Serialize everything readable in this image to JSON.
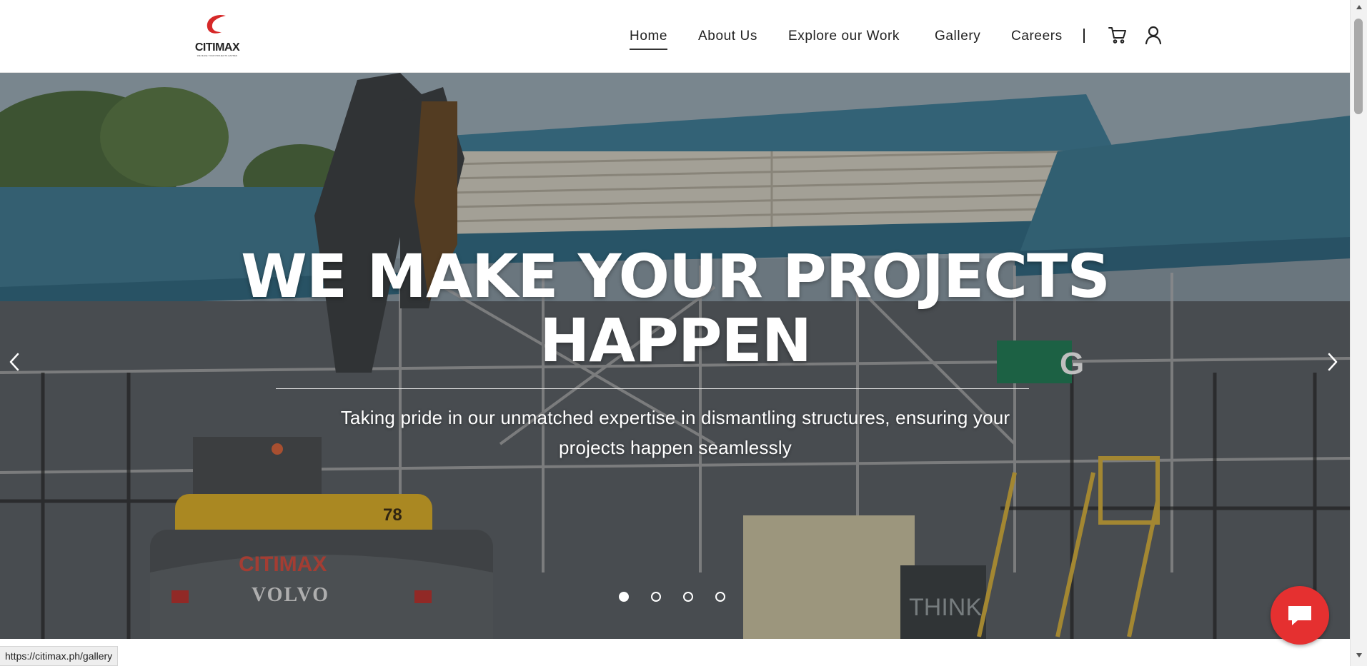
{
  "brand": {
    "name": "CITIMAX",
    "tagline": "WE MAKE YOUR PROJECTS HAPPEN",
    "accent_color": "#d62828"
  },
  "nav": {
    "items": [
      {
        "label": "Home",
        "active": true
      },
      {
        "label": "About Us",
        "active": false
      },
      {
        "label": "Explore our Work",
        "active": false
      },
      {
        "label": "Gallery",
        "active": false
      },
      {
        "label": "Careers",
        "active": false
      }
    ],
    "cart_icon": "cart-icon",
    "account_icon": "user-icon"
  },
  "hero": {
    "title": "WE MAKE YOUR PROJECTS HAPPEN",
    "subtitle": "Taking pride in our unmatched expertise in dismantling structures, ensuring your projects happen seamlessly",
    "prev_icon": "chevron-left-icon",
    "next_icon": "chevron-right-icon",
    "slides_total": 4,
    "active_slide": 1,
    "excavator_brand": "VOLVO",
    "excavator_number": "78",
    "excavator_decal": "CITIMAX",
    "sign_text": "THINK",
    "station_sign": "G"
  },
  "chat": {
    "icon": "chat-bubble-icon",
    "color": "#e53030"
  },
  "status_bar": {
    "url": "https://citimax.ph/gallery"
  }
}
